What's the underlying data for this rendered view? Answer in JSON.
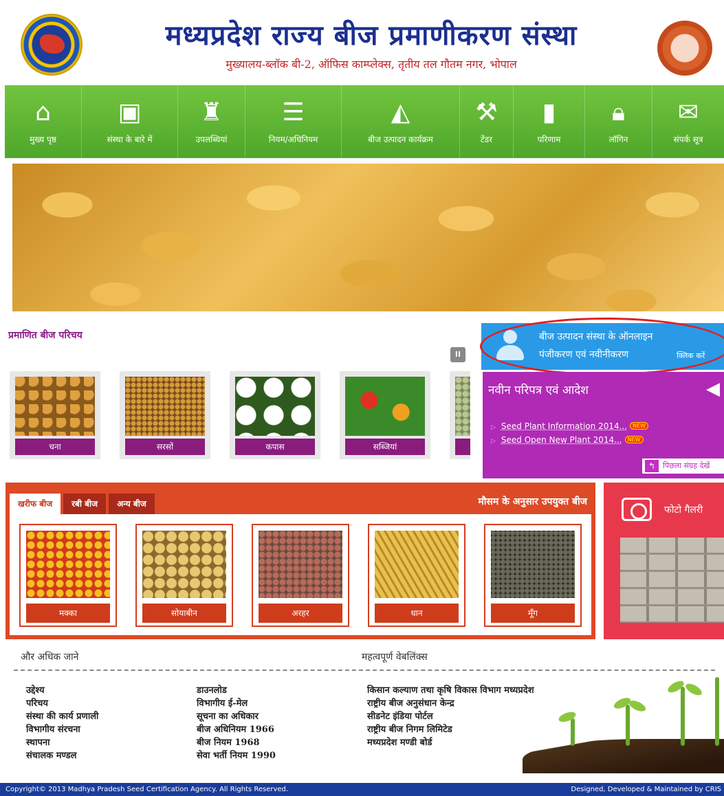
{
  "header": {
    "title": "मध्यप्रदेश राज्य बीज प्रमाणीकरण संस्था",
    "address": "मुख्यालय-ब्लॉक बी-2, ऑफिस काम्प्लेक्स, तृतीय तल गौतम नगर, भोपाल"
  },
  "nav": {
    "items": [
      {
        "label": "मुख्य पृष्ठ",
        "icon": "home-icon"
      },
      {
        "label": "संस्था के बारे में",
        "icon": "briefcase-icon"
      },
      {
        "label": "उपलब्धियां",
        "icon": "trophy-icon"
      },
      {
        "label": "नियम/अधिनियम",
        "icon": "list-icon"
      },
      {
        "label": "बीज उत्पादन कार्यक्रम",
        "icon": "chart-icon"
      },
      {
        "label": "टेंडर",
        "icon": "gavel-icon"
      },
      {
        "label": "परिणाम",
        "icon": "book-icon"
      },
      {
        "label": "लॉगिन",
        "icon": "lock-icon"
      },
      {
        "label": "संपर्क सूत्र",
        "icon": "mail-icon"
      }
    ]
  },
  "certified": {
    "title": "प्रमाणित बीज परिचय",
    "pause": "II",
    "items": [
      "चना",
      "सरसों",
      "कपास",
      "सब्जियां"
    ]
  },
  "registration": {
    "line1": "बीज उत्पादन संस्था के ऑनलाइन",
    "line2": "पंजीकरण एवं नवीनीकरण",
    "click": "क्लिक करें"
  },
  "circulars": {
    "title": "नवीन परिपत्र एवं आदेश",
    "items": [
      {
        "text": "Seed Plant Information 2014...",
        "badge": "NEW"
      },
      {
        "text": "Seed Open New Plant 2014...",
        "badge": "NEW"
      }
    ],
    "previous": "पिछला संग्रह देखें"
  },
  "season": {
    "tabs": [
      "खरीफ बीज",
      "रबी बीज",
      "अन्य बीज"
    ],
    "heading": "मौसम के अनुसार उपयुक्त बीज",
    "cards": [
      "मक्का",
      "सोयाबीन",
      "अरहर",
      "धान",
      "मूँग"
    ]
  },
  "gallery": {
    "title": "फोटो गैलरी"
  },
  "know_more": {
    "title": "और अधिक जाने",
    "col1": [
      "उद्देश्य",
      "परिचय",
      "संस्था की कार्य प्रणाली",
      "विभागीय संरचना",
      "स्थापना",
      "संचालक मण्डल"
    ],
    "col2": [
      "डाउनलोड",
      "विभागीय ई-मेल",
      "सूचना का अधिकार",
      "बीज अधिनियम 1966",
      "बीज नियम 1968",
      "सेवा भर्ती नियम 1990"
    ]
  },
  "weblinks": {
    "title": "महत्वपूर्ण वेबलिंक्स",
    "items": [
      "किसान कल्याण तथा कृषि विकास विभाग मध्यप्रदेश",
      "राष्ट्रीय बीज अनुसंधान केन्द्र",
      "सीडनेट इंडिया पोर्टल",
      "राष्ट्रीय बीज निगम लिमिटेड",
      "मध्यप्रदेश मण्डी बोर्ड"
    ]
  },
  "footer": {
    "copyright": "Copyright© 2013 Madhya Pradesh Seed Certification Agency. All Rights Reserved.",
    "credit": "Designed, Developed & Maintained by CRIS"
  }
}
